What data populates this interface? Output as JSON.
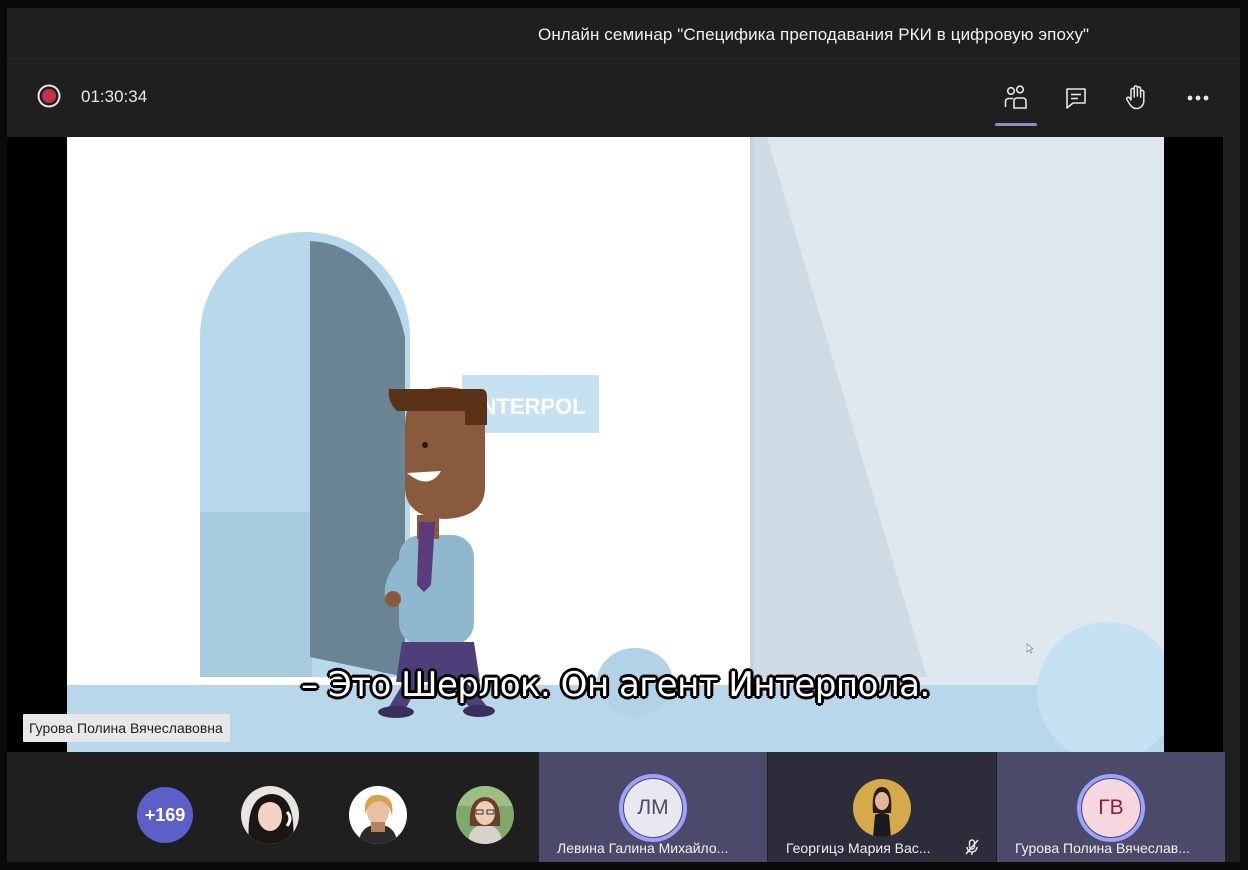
{
  "meeting": {
    "title": "Онлайн семинар \"Специфика преподавания РКИ в цифровую эпоху\"",
    "recording_time": "01:30:34"
  },
  "controls": [
    {
      "name": "participants",
      "icon": "people-icon"
    },
    {
      "name": "chat",
      "icon": "chat-icon"
    },
    {
      "name": "raise-hand",
      "icon": "hand-icon"
    },
    {
      "name": "more",
      "icon": "more-icon"
    }
  ],
  "video": {
    "sign_text": "INTERPOL",
    "subtitle": "– Это Шерлок. Он агент Интерпола.",
    "presenter": "Гурова Полина Вячеславовна"
  },
  "participants": {
    "more_count": "+169",
    "tiles": [
      {
        "initials": "ЛМ",
        "name": "Левина Галина Михайло..."
      },
      {
        "name": "Георгицэ Мария Вас...",
        "muted": true
      },
      {
        "initials": "ГВ",
        "name": "Гурова Полина Вячеслав..."
      }
    ]
  },
  "colors": {
    "accent": "#5b5fc7",
    "record": "#c4314b",
    "ring": "#9ea2ff"
  }
}
